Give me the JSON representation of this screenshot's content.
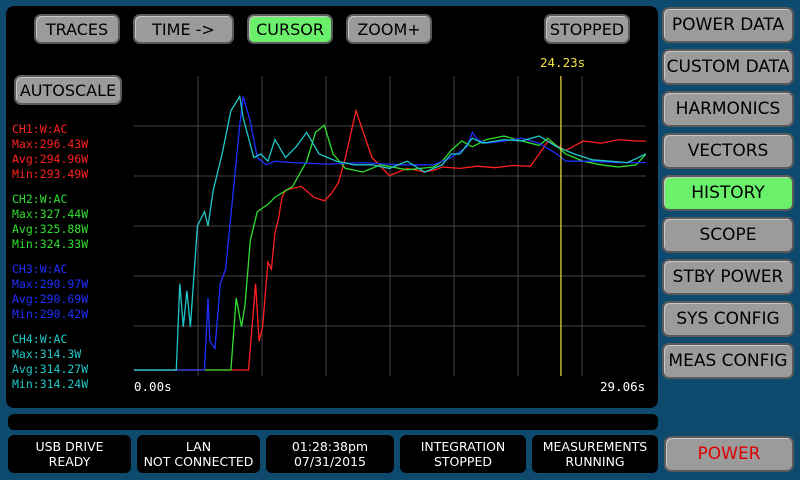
{
  "toolbar": {
    "traces": "TRACES",
    "time": "TIME ->",
    "cursor": "CURSOR",
    "zoom": "ZOOM+",
    "stopped": "STOPPED",
    "autoscale": "AUTOSCALE"
  },
  "sidebar": {
    "items": [
      {
        "label": "POWER DATA"
      },
      {
        "label": "CUSTOM DATA"
      },
      {
        "label": "HARMONICS"
      },
      {
        "label": "VECTORS"
      },
      {
        "label": "HISTORY",
        "active": true
      },
      {
        "label": "SCOPE"
      },
      {
        "label": "STBY POWER"
      },
      {
        "label": "SYS CONFIG"
      },
      {
        "label": "MEAS CONFIG"
      }
    ],
    "power": "POWER"
  },
  "channels": [
    {
      "name": "CH1:W:AC",
      "max": "Max:296.43W",
      "avg": "Avg:294.96W",
      "min": "Min:293.49W",
      "color": "#ff2020"
    },
    {
      "name": "CH2:W:AC",
      "max": "Max:327.44W",
      "avg": "Avg:325.88W",
      "min": "Min:324.33W",
      "color": "#30e030"
    },
    {
      "name": "CH3:W:AC",
      "max": "Max:290.97W",
      "avg": "Avg:290.69W",
      "min": "Min:290.42W",
      "color": "#2030ff"
    },
    {
      "name": "CH4:W:AC",
      "max": "Max:314.3W",
      "avg": "Avg:314.27W",
      "min": "Min:314.24W",
      "color": "#20c8c8"
    }
  ],
  "plot": {
    "time_start": "0.00s",
    "time_end": "29.06s",
    "cursor_time": "24.23s",
    "cursor_seconds": 24.23,
    "duration_seconds": 29.06,
    "cursor_color": "#f0e040"
  },
  "status": {
    "usb": {
      "line1": "USB DRIVE",
      "line2": "READY"
    },
    "lan": {
      "line1": "LAN",
      "line2": "NOT CONNECTED"
    },
    "clock": {
      "line1": "01:28:38pm",
      "line2": "07/31/2015"
    },
    "integration": {
      "line1": "INTEGRATION",
      "line2": "STOPPED"
    },
    "measurements": {
      "line1": "MEASUREMENTS",
      "line2": "RUNNING"
    }
  },
  "chart_data": {
    "type": "line",
    "xlabel": "",
    "ylabel": "",
    "xlim": [
      0,
      29.06
    ],
    "grid": true,
    "series": [
      {
        "name": "CH1:W:AC",
        "color": "#ff2020",
        "x": [
          0,
          6.5,
          6.9,
          7.1,
          7.3,
          7.6,
          7.8,
          8.0,
          8.2,
          8.4,
          8.6,
          9.5,
          10.2,
          10.8,
          11.2,
          11.6,
          12.0,
          12.6,
          13.5,
          14.5,
          15.5,
          16.5,
          17.1,
          17.5,
          18.5,
          19.5,
          20.5,
          21.5,
          22.5,
          23.0,
          23.5,
          24.5,
          25.5,
          26.5,
          27.5,
          28.5,
          29.06
        ],
        "y": [
          0,
          0,
          120,
          40,
          60,
          150,
          140,
          190,
          210,
          240,
          250,
          255,
          240,
          235,
          245,
          260,
          295,
          360,
          295,
          270,
          280,
          275,
          278,
          282,
          280,
          283,
          281,
          284,
          283,
          300,
          318,
          305,
          318,
          315,
          320,
          318,
          318
        ]
      },
      {
        "name": "CH2:W:AC",
        "color": "#30e030",
        "x": [
          0,
          5.5,
          5.8,
          6.1,
          6.3,
          6.6,
          7.0,
          7.6,
          8.0,
          9.0,
          9.8,
          10.3,
          10.8,
          11.3,
          12.0,
          13.0,
          14.0,
          15.5,
          17.0,
          17.5,
          18.0,
          18.6,
          19.2,
          20.0,
          21.0,
          22.0,
          23.0,
          23.5,
          24.5,
          25.5,
          26.5,
          27.5,
          28.5,
          29.06
        ],
        "y": [
          0,
          0,
          100,
          60,
          90,
          180,
          220,
          230,
          240,
          255,
          290,
          330,
          340,
          300,
          280,
          275,
          285,
          278,
          282,
          290,
          305,
          318,
          310,
          320,
          325,
          318,
          312,
          322,
          300,
          290,
          285,
          282,
          285,
          300
        ]
      },
      {
        "name": "CH3:W:AC",
        "color": "#2030ff",
        "x": [
          0,
          4.0,
          4.2,
          4.3,
          4.6,
          4.9,
          5.2,
          5.6,
          6.0,
          6.2,
          6.6,
          7.0,
          7.5,
          8.0,
          9.0,
          11.0,
          13.0,
          15.0,
          17.0,
          18.0,
          18.9,
          19.2,
          19.5,
          20.0,
          21.0,
          22.0,
          23.0,
          24.0,
          24.5,
          26.0,
          27.5,
          29.06
        ],
        "y": [
          0,
          0,
          100,
          40,
          30,
          120,
          140,
          240,
          340,
          380,
          345,
          295,
          285,
          290,
          288,
          286,
          288,
          285,
          285,
          295,
          310,
          330,
          320,
          315,
          318,
          322,
          315,
          300,
          290,
          290,
          288,
          288
        ]
      },
      {
        "name": "CH4:W:AC",
        "color": "#20c8c8",
        "x": [
          0,
          2.4,
          2.6,
          2.8,
          3.0,
          3.2,
          3.6,
          4.0,
          4.2,
          4.5,
          5.0,
          5.5,
          6.0,
          6.2,
          6.8,
          7.2,
          7.6,
          8.0,
          8.6,
          9.2,
          9.8,
          10.5,
          11.5,
          12.5,
          13.5,
          14.5,
          15.5,
          16.5,
          17.5,
          18.0,
          18.5,
          19.2,
          19.8,
          21.0,
          22.0,
          23.0,
          24.0,
          25.0,
          26.0,
          27.0,
          28.0,
          29.06
        ],
        "y": [
          0,
          0,
          120,
          60,
          110,
          60,
          200,
          220,
          200,
          250,
          300,
          360,
          380,
          350,
          295,
          300,
          290,
          320,
          295,
          310,
          330,
          300,
          290,
          285,
          285,
          280,
          290,
          275,
          285,
          300,
          300,
          322,
          315,
          320,
          318,
          325,
          310,
          300,
          292,
          290,
          288,
          300
        ]
      }
    ]
  }
}
